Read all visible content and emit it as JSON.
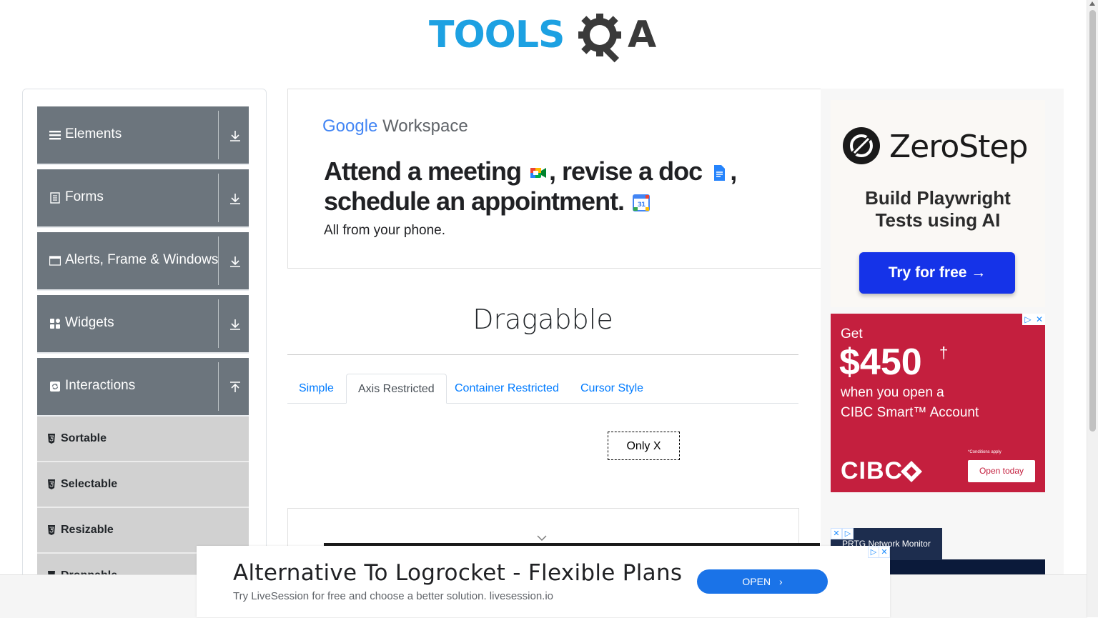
{
  "logo": {
    "tools": "TOOLS",
    "a": "A"
  },
  "sidebar": {
    "groups": [
      {
        "label": "Elements",
        "icon": "menu-lines-icon"
      },
      {
        "label": "Forms",
        "icon": "form-doc-icon"
      },
      {
        "label": "Alerts, Frame & Windows",
        "icon": "window-icon"
      },
      {
        "label": "Widgets",
        "icon": "widgets-grid-icon"
      },
      {
        "label": "Interactions",
        "icon": "refresh-icon"
      }
    ],
    "sub_items": [
      "Sortable",
      "Selectable",
      "Resizable",
      "Droppable"
    ]
  },
  "google_ad": {
    "brand_google": "Google",
    "brand_workspace": "Workspace",
    "headline_1": "Attend a meeting",
    "headline_2": ", revise a doc",
    "headline_3": ",",
    "headline_4": "schedule an appointment.",
    "calendar_day": "31",
    "sub": "All from your phone."
  },
  "page": {
    "title": "Dragabble",
    "tabs": [
      "Simple",
      "Axis Restricted",
      "Container Restricted",
      "Cursor Style"
    ],
    "active_tab": "Axis Restricted",
    "drag_box": "Only X"
  },
  "zerostep_ad": {
    "name": "ZeroStep",
    "tagline_1": "Build Playwright",
    "tagline_2": "Tests using AI",
    "button": "Try for free →"
  },
  "cibc_ad": {
    "get": "Get",
    "amount": "$450",
    "dagger": "†",
    "copy_1": "when you open a",
    "copy_2": "CIBC Smart™ Account",
    "logo": "CIBC",
    "conditions": "*Conditions apply",
    "button": "Open today"
  },
  "prtg_ad": {
    "label": "PRTG Network Monitor"
  },
  "anchor_ad": {
    "title": "Alternative To Logrocket - Flexible Plans",
    "sub": "Try LiveSession for free and choose a better solution. livesession.io",
    "button": "OPEN"
  },
  "colors": {
    "sidebar_group": "#6c757d",
    "sidebar_sub": "#d1d1d1",
    "link_blue": "#007bff",
    "tools_blue": "#1da1e2",
    "zerostep_button": "#1533e8",
    "cibc_red": "#c41f3e"
  }
}
